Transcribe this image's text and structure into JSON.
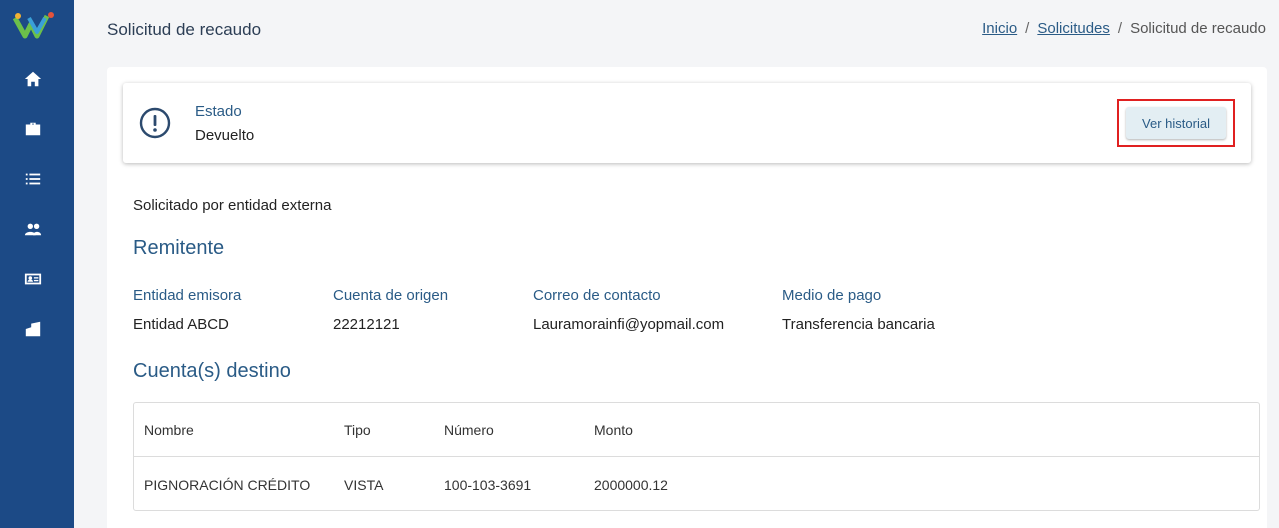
{
  "header": {
    "title": "Solicitud de recaudo",
    "breadcrumb": [
      {
        "label": "Inicio"
      },
      {
        "label": "Solicitudes"
      },
      {
        "label": "Solicitud de recaudo"
      }
    ],
    "separator": "/"
  },
  "sidebar": {
    "items": [
      {
        "icon": "home-icon"
      },
      {
        "icon": "briefcase-icon"
      },
      {
        "icon": "list-icon"
      },
      {
        "icon": "users-icon"
      },
      {
        "icon": "id-card-icon"
      },
      {
        "icon": "building-icon"
      }
    ]
  },
  "status": {
    "label": "Estado",
    "value": "Devuelto",
    "history_button": "Ver historial"
  },
  "requested_by": "Solicitado por entidad externa",
  "sender": {
    "title": "Remitente",
    "fields": [
      {
        "label": "Entidad emisora",
        "value": "Entidad ABCD"
      },
      {
        "label": "Cuenta de origen",
        "value": "22212121"
      },
      {
        "label": "Correo de contacto",
        "value": "Lauramorainfi@yopmail.com"
      },
      {
        "label": "Medio de pago",
        "value": "Transferencia bancaria"
      }
    ]
  },
  "destination": {
    "title": "Cuenta(s) destino",
    "columns": [
      "Nombre",
      "Tipo",
      "Número",
      "Monto"
    ],
    "rows": [
      [
        "PIGNORACIÓN CRÉDITO",
        "VISTA",
        "100-103-3691",
        "2000000.12"
      ]
    ]
  },
  "colors": {
    "sidebar": "#1c4a86",
    "accent": "#2a5b86",
    "highlight": "#e02020"
  }
}
